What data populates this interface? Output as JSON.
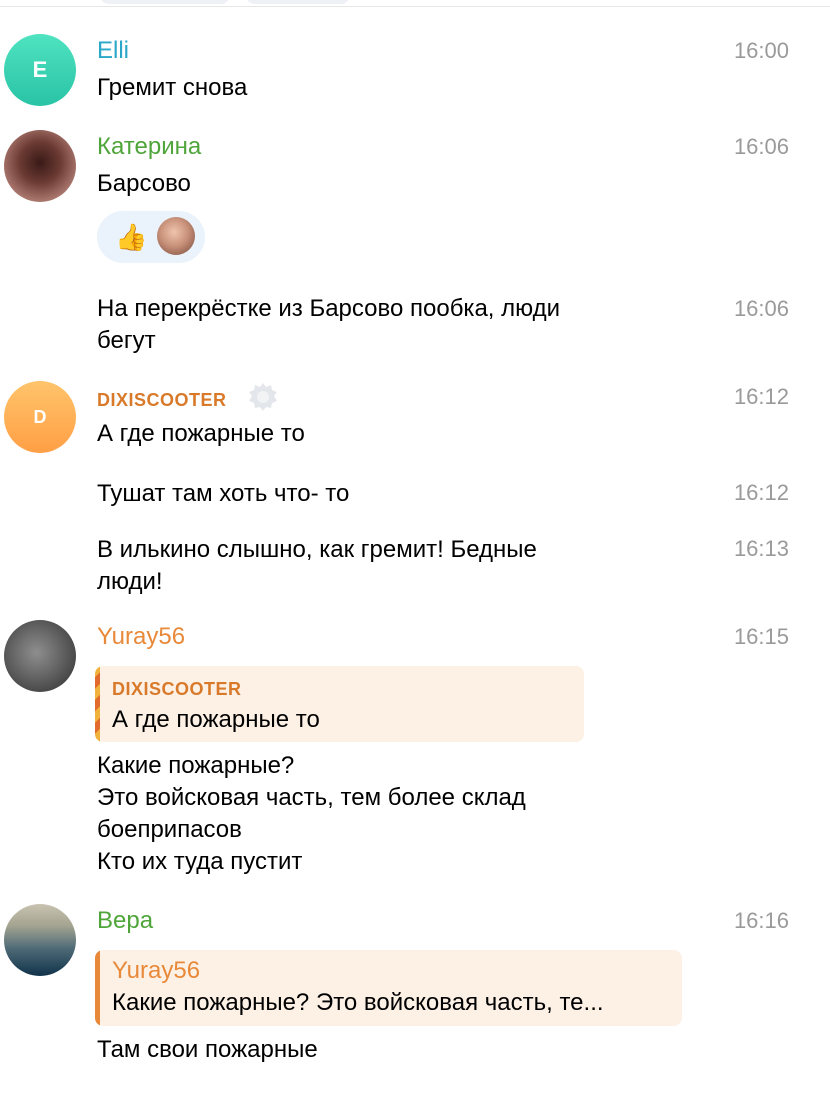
{
  "messages": {
    "m1": {
      "avatar_letter": "E",
      "name": "Elli",
      "text": "Гремит снова",
      "time": "16:00"
    },
    "m2": {
      "name": "Катерина",
      "text": "Барсово",
      "time": "16:06",
      "reaction_emoji": "👍"
    },
    "m3": {
      "text_line1": "На перекрёстке из Барсово пообка, люди",
      "text_line2": "бегут",
      "time": "16:06"
    },
    "m4": {
      "avatar_letter": "D",
      "name": "DIXISCOOTER",
      "text": "А где пожарные то",
      "time": "16:12"
    },
    "m5": {
      "text": "Тушат там хоть что- то",
      "time": "16:12"
    },
    "m6": {
      "text_line1": "В илькино слышно, как гремит! Бедные",
      "text_line2": "люди!",
      "time": "16:13"
    },
    "m7": {
      "name": "Yuray56",
      "time": "16:15",
      "reply": {
        "name": "DIXISCOOTER",
        "text": "А где пожарные то"
      },
      "lines": [
        "Какие пожарные?",
        "Это войсковая часть, тем более склад",
        "боеприпасов",
        "Кто их туда пустит"
      ]
    },
    "m8": {
      "name": "Вера",
      "time": "16:16",
      "reply": {
        "name": "Yuray56",
        "text": "Какие пожарные? Это войсковая часть, те..."
      },
      "text": "Там свои пожарные"
    }
  },
  "colors": {
    "elli_name": "#2aa7c9",
    "green_name": "#4fa53a",
    "orange_name": "#e8893a",
    "dixi_name": "#d97a2b",
    "timestamp": "#9a9a9a",
    "reply_background": "#fdf1e6",
    "reaction_background": "#eaf2fb"
  },
  "icons": {
    "premium_badge": "verified-badge-icon",
    "reaction": "thumbs-up-icon"
  }
}
